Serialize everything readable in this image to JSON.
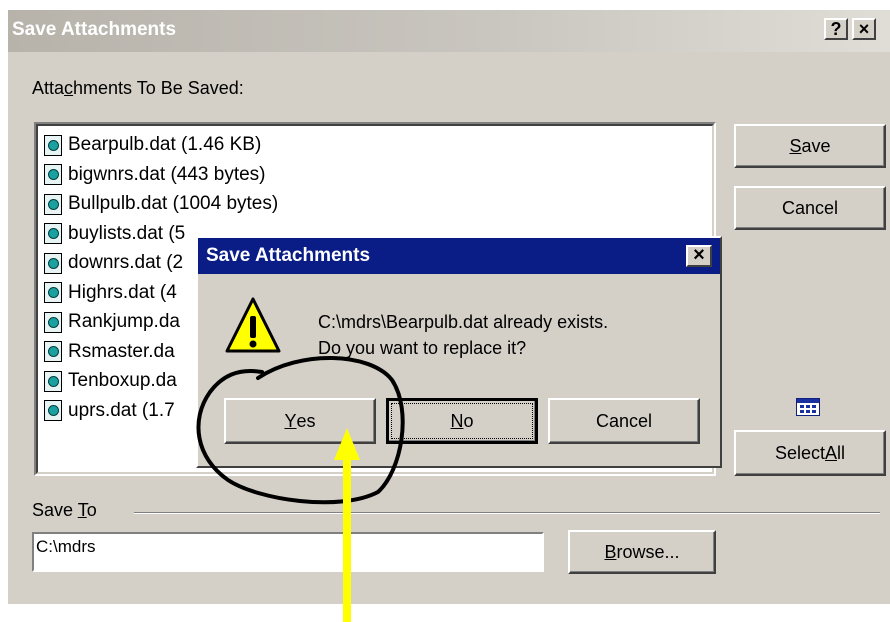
{
  "window": {
    "title": "Save Attachments",
    "help_label": "?",
    "close_label": "×"
  },
  "attachments": {
    "label_pre": "Atta",
    "label_accel": "c",
    "label_post": "hments To Be Saved:",
    "files": [
      "Bearpulb.dat (1.46 KB)",
      "bigwnrs.dat (443 bytes)",
      "Bullpulb.dat (1004 bytes)",
      "buylists.dat (5",
      "downrs.dat (2",
      "Highrs.dat (4",
      "Rankjump.da",
      "Rsmaster.da",
      "Tenboxup.da",
      "uprs.dat (1.7"
    ]
  },
  "side_buttons": {
    "save_accel": "S",
    "save_rest": "ave",
    "cancel": "Cancel",
    "select_all_pre": "Select ",
    "select_all_accel": "A",
    "select_all_post": "ll"
  },
  "save_to": {
    "label_pre": "Save ",
    "label_accel": "T",
    "label_post": "o",
    "value": "C:\\mdrs",
    "browse_accel": "B",
    "browse_rest": "rowse..."
  },
  "modal": {
    "title": "Save Attachments",
    "close_label": "×",
    "message_line1": "C:\\mdrs\\Bearpulb.dat already exists.",
    "message_line2": "Do you want to replace it?",
    "yes_accel": "Y",
    "yes_rest": "es",
    "no_accel": "N",
    "no_rest": "o",
    "cancel": "Cancel"
  },
  "colors": {
    "modal_titlebar": "#0a1c86",
    "annotation_arrow": "#ffff00",
    "annotation_circle": "#000000"
  }
}
